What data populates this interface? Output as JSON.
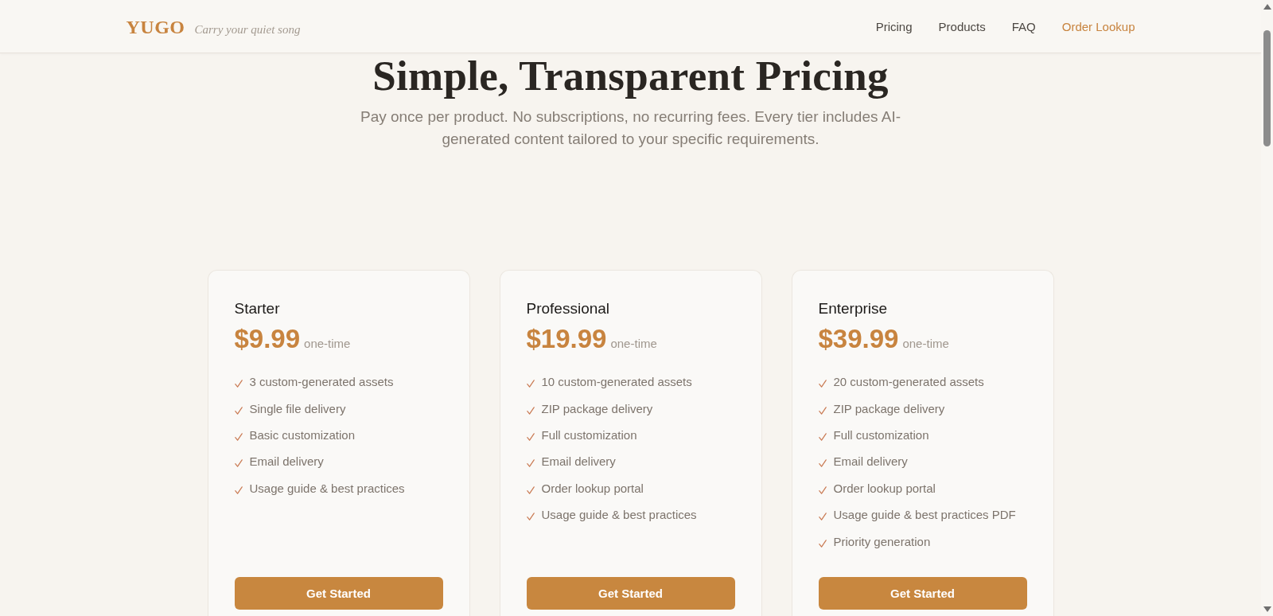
{
  "header": {
    "logo": "YUGO",
    "tagline": "Carry your quiet song",
    "nav": [
      {
        "label": "Pricing",
        "kind": "link"
      },
      {
        "label": "Products",
        "kind": "link"
      },
      {
        "label": "FAQ",
        "kind": "link"
      },
      {
        "label": "Order Lookup",
        "kind": "accent"
      }
    ]
  },
  "hero": {
    "title": "Simple, Transparent Pricing",
    "subtitle": "Pay once per product. No subscriptions, no recurring fees. Every tier includes AI-generated content tailored to your specific requirements."
  },
  "plans": [
    {
      "name": "Starter",
      "price": "$9.99",
      "term": "one-time",
      "features": [
        "3 custom-generated assets",
        "Single file delivery",
        "Basic customization",
        "Email delivery",
        "Usage guide & best practices"
      ],
      "button": "Get Started"
    },
    {
      "name": "Professional",
      "price": "$19.99",
      "term": "one-time",
      "features": [
        "10 custom-generated assets",
        "ZIP package delivery",
        "Full customization",
        "Email delivery",
        "Order lookup portal",
        "Usage guide & best practices"
      ],
      "button": "Get Started"
    },
    {
      "name": "Enterprise",
      "price": "$39.99",
      "term": "one-time",
      "features": [
        "20 custom-generated assets",
        "ZIP package delivery",
        "Full customization",
        "Email delivery",
        "Order lookup portal",
        "Usage guide & best practices PDF",
        "Priority generation"
      ],
      "button": "Get Started"
    }
  ]
}
